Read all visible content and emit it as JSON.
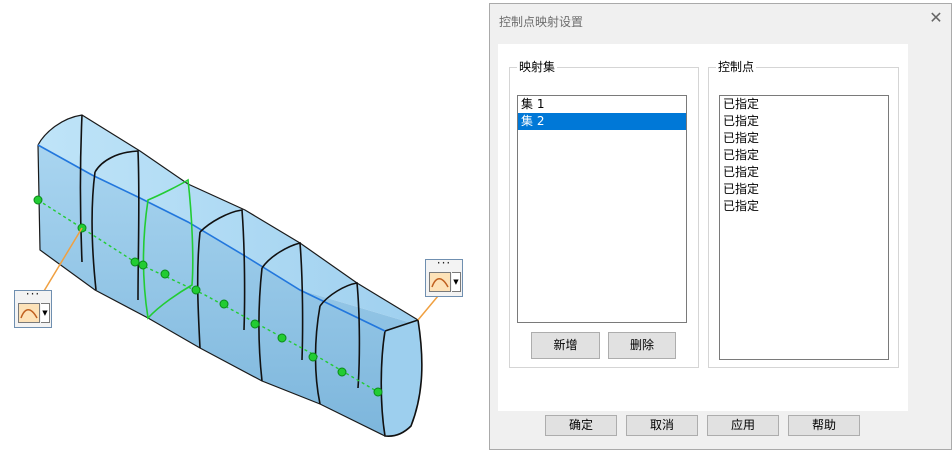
{
  "dialog": {
    "title": "控制点映射设置",
    "close_glyph": "✕",
    "map_group": {
      "label": "映射集",
      "items": [
        "集 1",
        "集 2"
      ],
      "selected_index": 1,
      "add_label": "新增",
      "delete_label": "删除"
    },
    "cp_group": {
      "label": "控制点",
      "items": [
        "已指定",
        "已指定",
        "已指定",
        "已指定",
        "已指定",
        "已指定",
        "已指定"
      ]
    },
    "footer": {
      "ok_label": "确定",
      "cancel_label": "取消",
      "apply_label": "应用",
      "help_label": "帮助"
    }
  },
  "viewport": {
    "handle_dots": "···",
    "colors": {
      "solid_fill": "#a9d7f2",
      "section_line": "#111111",
      "spine_line": "#2277dd",
      "control_point": "#22cc33",
      "leader": "#f0a040"
    },
    "icons": [
      "curve-map-icon",
      "dropdown-arrow-icon"
    ]
  }
}
